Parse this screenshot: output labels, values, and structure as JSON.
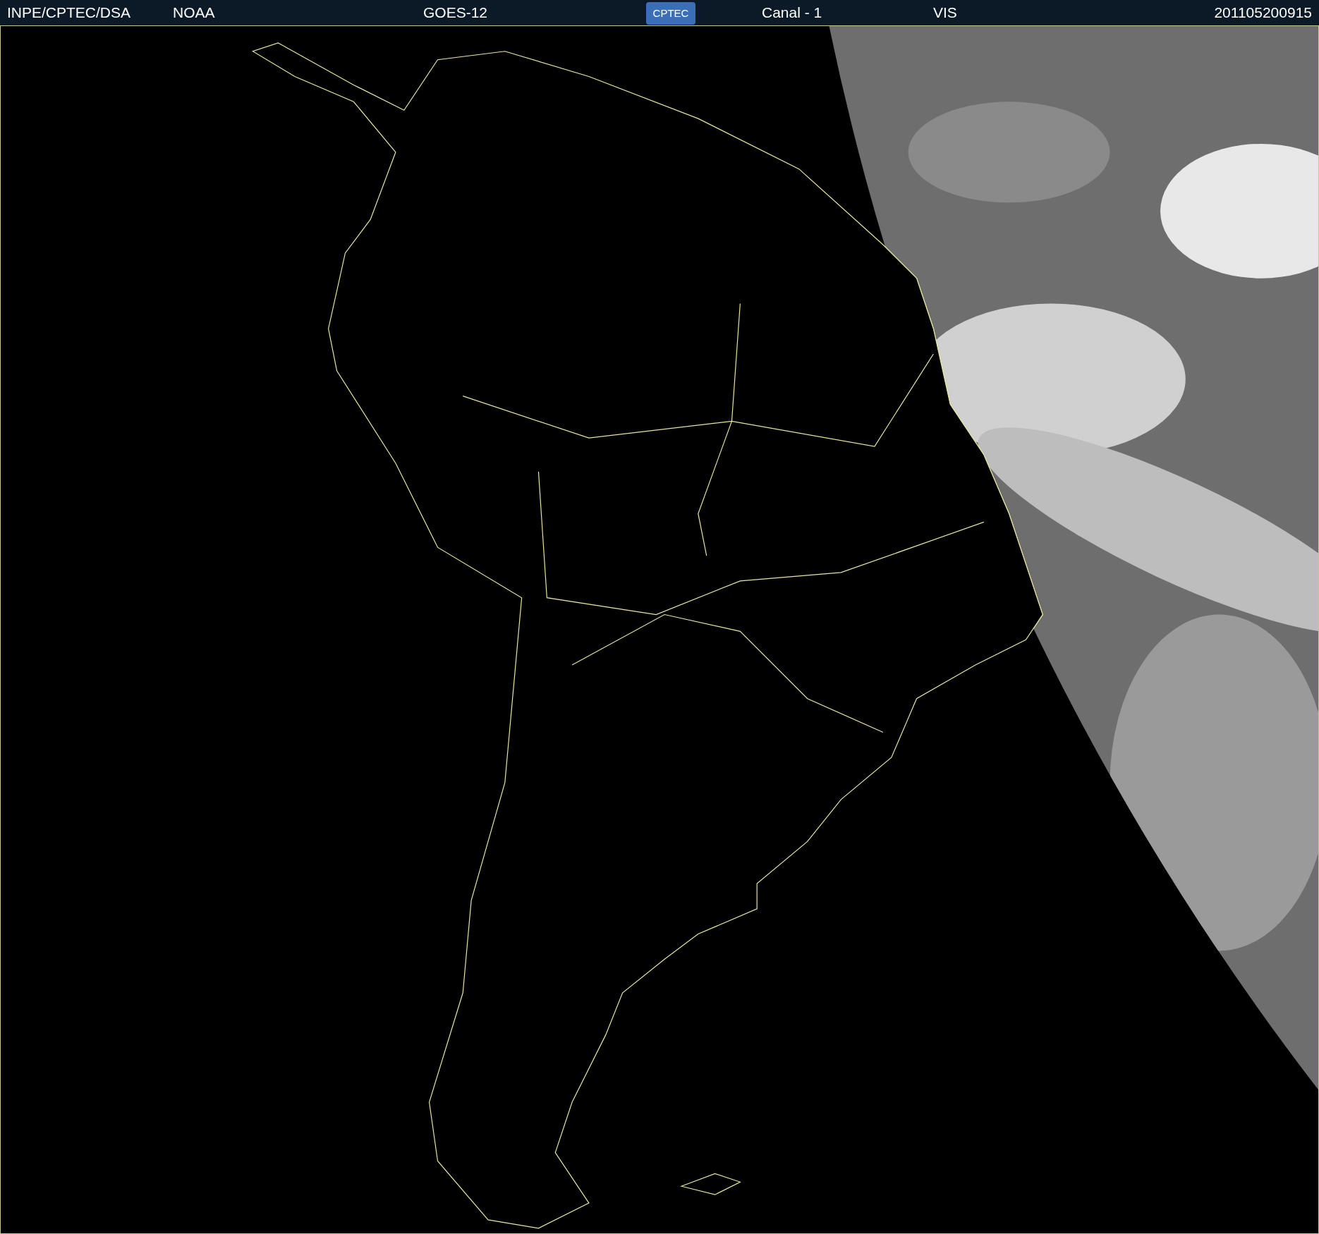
{
  "header": {
    "labels": [
      "INPE/CPTEC/DSA",
      "NOAA",
      "GOES-12"
    ],
    "logo": "CPTEC",
    "channel": "Canal - 1",
    "band": "VIS",
    "timestamp": "201105200915"
  }
}
